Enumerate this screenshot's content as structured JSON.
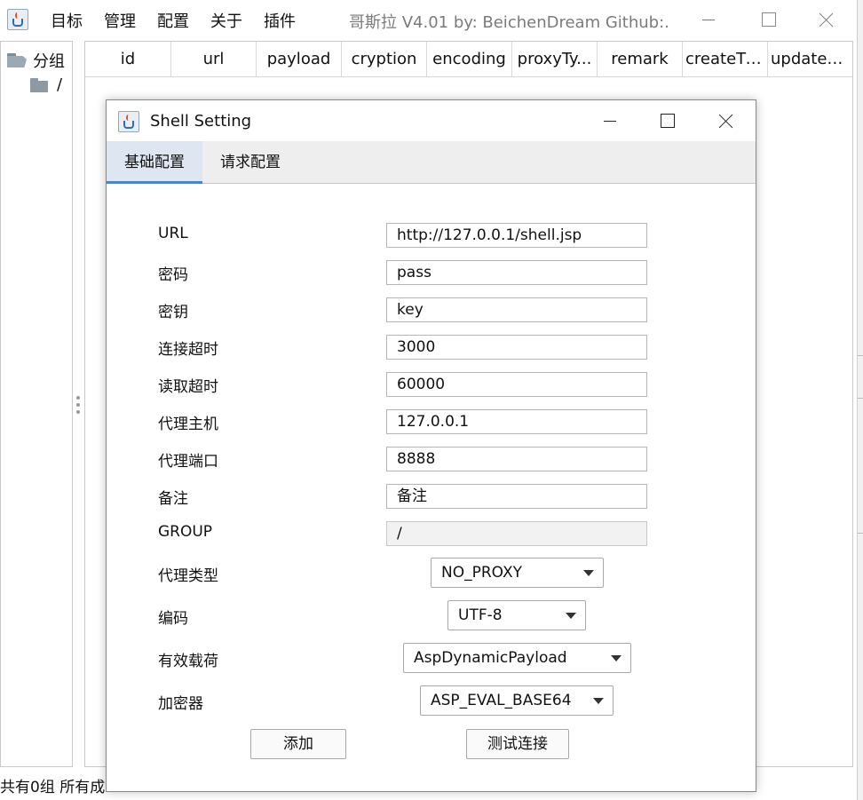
{
  "main_window": {
    "title": "哥斯拉   V4.01 by: BeichenDream Github:...",
    "menu": [
      "目标",
      "管理",
      "配置",
      "关于",
      "插件"
    ]
  },
  "tree": {
    "root_label": "分组",
    "child_label": "/"
  },
  "table": {
    "columns": [
      "id",
      "url",
      "payload",
      "cryption",
      "encoding",
      "proxyTy...",
      "remark",
      "createTi...",
      "updateT..."
    ]
  },
  "status_bar": {
    "text": "共有0组 所有成"
  },
  "dialog": {
    "title": "Shell Setting",
    "tabs": [
      "基础配置",
      "请求配置"
    ],
    "active_tab": "基础配置",
    "fields": {
      "url": {
        "label": "URL",
        "value": "http://127.0.0.1/shell.jsp"
      },
      "password": {
        "label": "密码",
        "value": "pass"
      },
      "key": {
        "label": "密钥",
        "value": "key"
      },
      "connect_timeout": {
        "label": "连接超时",
        "value": "3000"
      },
      "read_timeout": {
        "label": "读取超时",
        "value": "60000"
      },
      "proxy_host": {
        "label": "代理主机",
        "value": "127.0.0.1"
      },
      "proxy_port": {
        "label": "代理端口",
        "value": "8888"
      },
      "remark": {
        "label": "备注",
        "value": "备注"
      },
      "group": {
        "label": "GROUP",
        "value": "/"
      }
    },
    "selects": {
      "proxy_type": {
        "label": "代理类型",
        "value": "NO_PROXY"
      },
      "encoding": {
        "label": "编码",
        "value": "UTF-8"
      },
      "payload": {
        "label": "有效载荷",
        "value": "AspDynamicPayload"
      },
      "cryption": {
        "label": "加密器",
        "value": "ASP_EVAL_BASE64"
      }
    },
    "buttons": {
      "add": "添加",
      "test": "测试连接"
    }
  },
  "colors": {
    "tab_active_bg": "#dde6f1",
    "tab_accent": "#4a87c7"
  }
}
